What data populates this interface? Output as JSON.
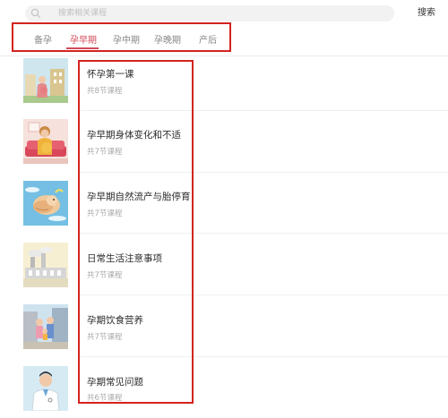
{
  "search": {
    "placeholder": "搜索相关课程",
    "button_label": "搜索"
  },
  "tabs": [
    {
      "label": "备孕"
    },
    {
      "label": "孕早期"
    },
    {
      "label": "孕中期"
    },
    {
      "label": "孕晚期"
    },
    {
      "label": "产后"
    }
  ],
  "active_tab": "孕早期",
  "courses": [
    {
      "title": "怀孕第一课",
      "count": "共8节课程",
      "thumb_icon": "pregnant-city-illustration"
    },
    {
      "title": "孕早期身体变化和不适",
      "count": "共7节课程",
      "thumb_icon": "pregnant-woman-sofa-illustration"
    },
    {
      "title": "孕早期自然流产与胎停育",
      "count": "共7节课程",
      "thumb_icon": "fetus-sky-illustration"
    },
    {
      "title": "日常生活注意事项",
      "count": "共7节课程",
      "thumb_icon": "factory-smoke-illustration"
    },
    {
      "title": "孕期饮食营养",
      "count": "共7节课程",
      "thumb_icon": "family-street-illustration"
    },
    {
      "title": "孕期常见问题",
      "count": "共6节课程",
      "thumb_icon": "doctor-illustration"
    }
  ],
  "colors": {
    "accent": "#d24c5a",
    "highlight_frame": "#d3231e"
  }
}
